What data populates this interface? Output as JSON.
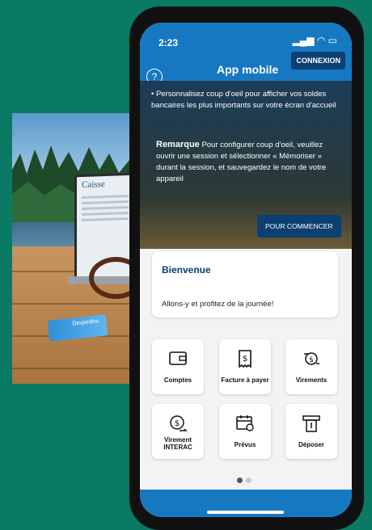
{
  "photo": {
    "laptop_brand": "Caisse",
    "card_brand": "Desjardins"
  },
  "status_bar": {
    "time": "2:23",
    "icons": "signal-wifi-battery"
  },
  "header": {
    "title": "App mobile",
    "help_label": "?",
    "login_button": "CONNEXION"
  },
  "banner": {
    "bullet_text": "Personnalisez coup d'oeil pour afficher vos soldes bancaires les plus importants sur votre écran d'accueil",
    "note_title": "Remarque",
    "note_text": "Pour configurer coup d'oeil, veuillez ouvrir une session et sélectionner « Mémoriser » durant la session, et sauvegardez le nom de votre appareil",
    "start_button": "POUR COMMENCER"
  },
  "welcome": {
    "title": "Bienvenue",
    "text": "Allons-y et profitez de la journée!"
  },
  "tiles": [
    {
      "label": "Comptes",
      "icon": "wallet-icon"
    },
    {
      "label": "Facture à payer",
      "icon": "bill-icon"
    },
    {
      "label": "Virements",
      "icon": "transfer-icon"
    },
    {
      "label": "Virement INTERAC",
      "icon": "interac-icon"
    },
    {
      "label": "Prévus",
      "icon": "calendar-icon"
    },
    {
      "label": "Déposer",
      "icon": "atm-icon"
    }
  ],
  "pagination": {
    "count": 2,
    "active": 1
  },
  "colors": {
    "brand_blue": "#1778c2",
    "dark_blue": "#0c3f72",
    "background": "#0a7a64"
  }
}
